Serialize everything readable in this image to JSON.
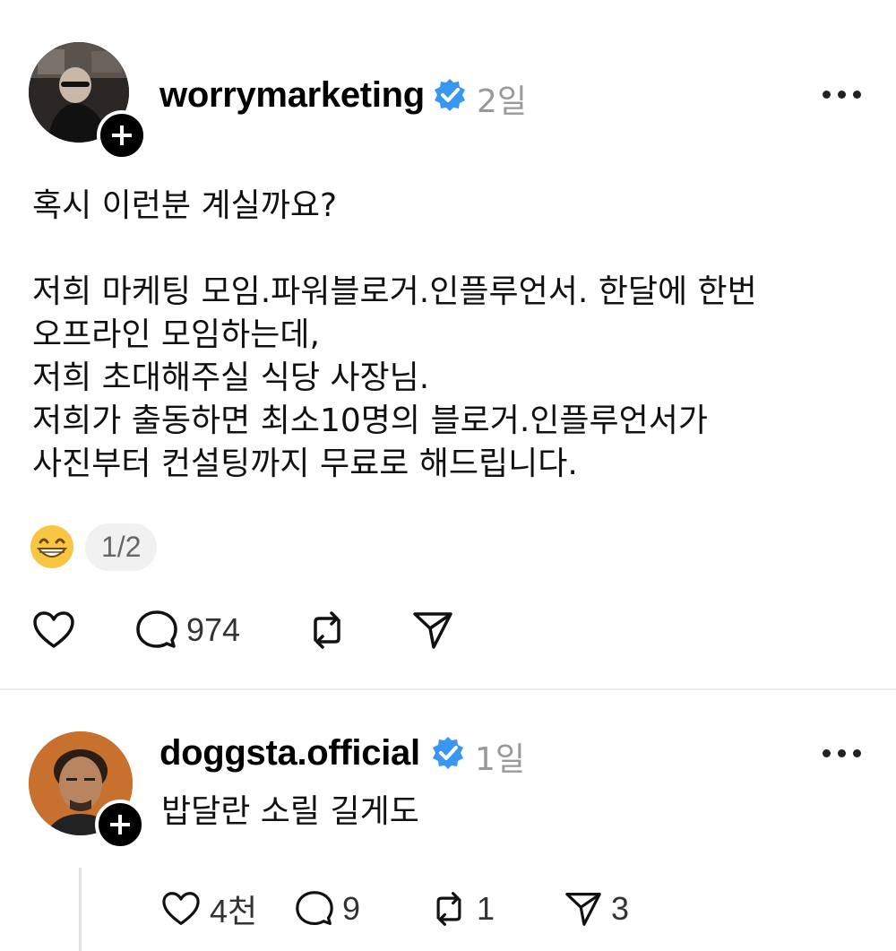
{
  "post": {
    "username": "worrymarketing",
    "time": "2일",
    "text": "혹시 이런분 계실까요?\n\n저희 마케팅 모임.파워블로거.인플루언서.  한달에 한번\n오프라인 모임하는데,\n저희 초대해주실 식당 사장님.\n저희가 출동하면 최소10명의 블로거.인플루언서가\n사진부터 컨설팅까지 무료로 해드립니다.",
    "emoji": "grinning-face",
    "page_indicator": "1/2",
    "actions": {
      "like_count": "",
      "comment_count": "974",
      "repost_count": "",
      "share_count": ""
    }
  },
  "reply": {
    "username": "doggsta.official",
    "time": "1일",
    "text": "밥달란 소릴 길게도",
    "actions": {
      "like_count": "4천",
      "comment_count": "9",
      "repost_count": "1",
      "share_count": "3"
    }
  },
  "colors": {
    "verified": "#3897f0",
    "muted": "#999999",
    "divider": "#ececec"
  }
}
